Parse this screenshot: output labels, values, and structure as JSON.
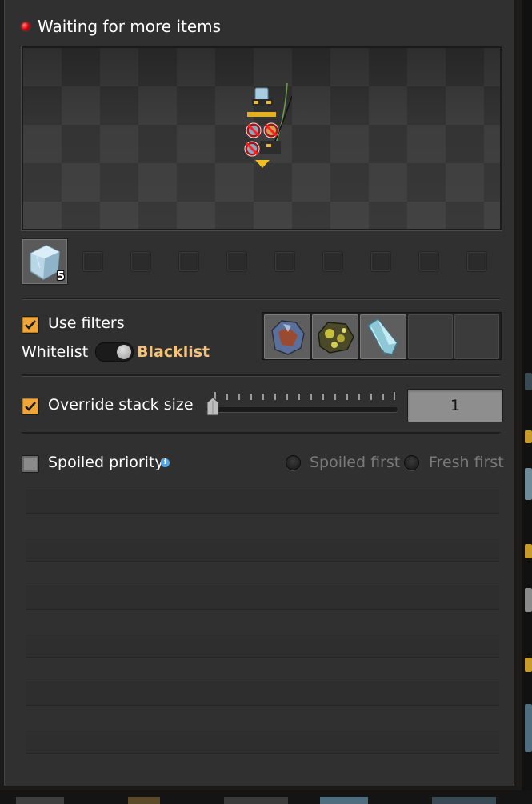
{
  "status": {
    "text": "Waiting for more items",
    "led_color": "#e00000"
  },
  "preview": {
    "entity": "inserter-icon"
  },
  "inventory": {
    "item_icon": "ice-icon",
    "item_count": "5",
    "empty_slots": 9
  },
  "filters": {
    "use_filters_label": "Use filters",
    "use_filters_checked": true,
    "whitelist_label": "Whitelist",
    "blacklist_label": "Blacklist",
    "mode": "Blacklist",
    "slots": [
      "iron-ore-icon",
      "sulfur-chunk-icon",
      "ice-crystal-icon",
      "",
      ""
    ]
  },
  "stack": {
    "override_label": "Override stack size",
    "override_checked": true,
    "value": "1"
  },
  "spoil": {
    "priority_label": "Spoiled priority",
    "priority_checked": false,
    "option_spoiled": "Spoiled first",
    "option_fresh": "Fresh first"
  },
  "colors": {
    "accent": "#f0a53a",
    "blacklist_text": "#f5c27a",
    "info": "#54a7e6"
  }
}
